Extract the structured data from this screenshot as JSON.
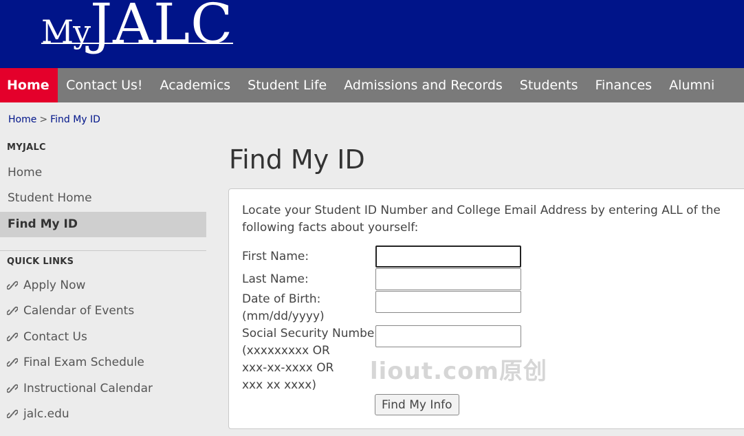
{
  "header": {
    "logo_my": "My",
    "logo_jalc": "JALC"
  },
  "nav": {
    "items": [
      {
        "label": "Home"
      },
      {
        "label": "Contact Us!"
      },
      {
        "label": "Academics"
      },
      {
        "label": "Student Life"
      },
      {
        "label": "Admissions and Records"
      },
      {
        "label": "Students"
      },
      {
        "label": "Finances"
      },
      {
        "label": "Alumni"
      }
    ],
    "active": "Home"
  },
  "breadcrumb": {
    "home": "Home",
    "separator": ">",
    "current": "Find My ID"
  },
  "sidebar": {
    "myjalc_heading": "MYJALC",
    "items": [
      {
        "label": "Home"
      },
      {
        "label": "Student Home"
      },
      {
        "label": "Find My ID"
      }
    ],
    "active": "Find My ID",
    "quick_links_heading": "QUICK LINKS",
    "quick_links": [
      {
        "label": "Apply Now"
      },
      {
        "label": "Calendar of Events"
      },
      {
        "label": "Contact Us"
      },
      {
        "label": "Final Exam Schedule"
      },
      {
        "label": "Instructional Calendar"
      },
      {
        "label": "jalc.edu"
      }
    ]
  },
  "main": {
    "title": "Find My ID",
    "intro": "Locate your Student ID Number and College Email Address by entering ALL of the following facts about yourself:",
    "form": {
      "first_name_label": "First Name:",
      "last_name_label": "Last Name:",
      "dob_label": "Date of Birth:",
      "dob_hint": "(mm/dd/yyyy)",
      "ssn_label": "Social Security Number:",
      "ssn_hint_1": "(xxxxxxxxx OR",
      "ssn_hint_2": "xxx-xx-xxxx OR",
      "ssn_hint_3": "xxx xx xxxx)",
      "first_name_value": "",
      "last_name_value": "",
      "dob_value": "",
      "ssn_value": "",
      "submit_label": "Find My Info"
    }
  },
  "watermark": "liout.com原创",
  "colors": {
    "header_bg": "#001489",
    "nav_bg": "#7a7a7a",
    "active_nav": "#e4002b"
  },
  "icons": {
    "quick_link": "link-icon"
  }
}
